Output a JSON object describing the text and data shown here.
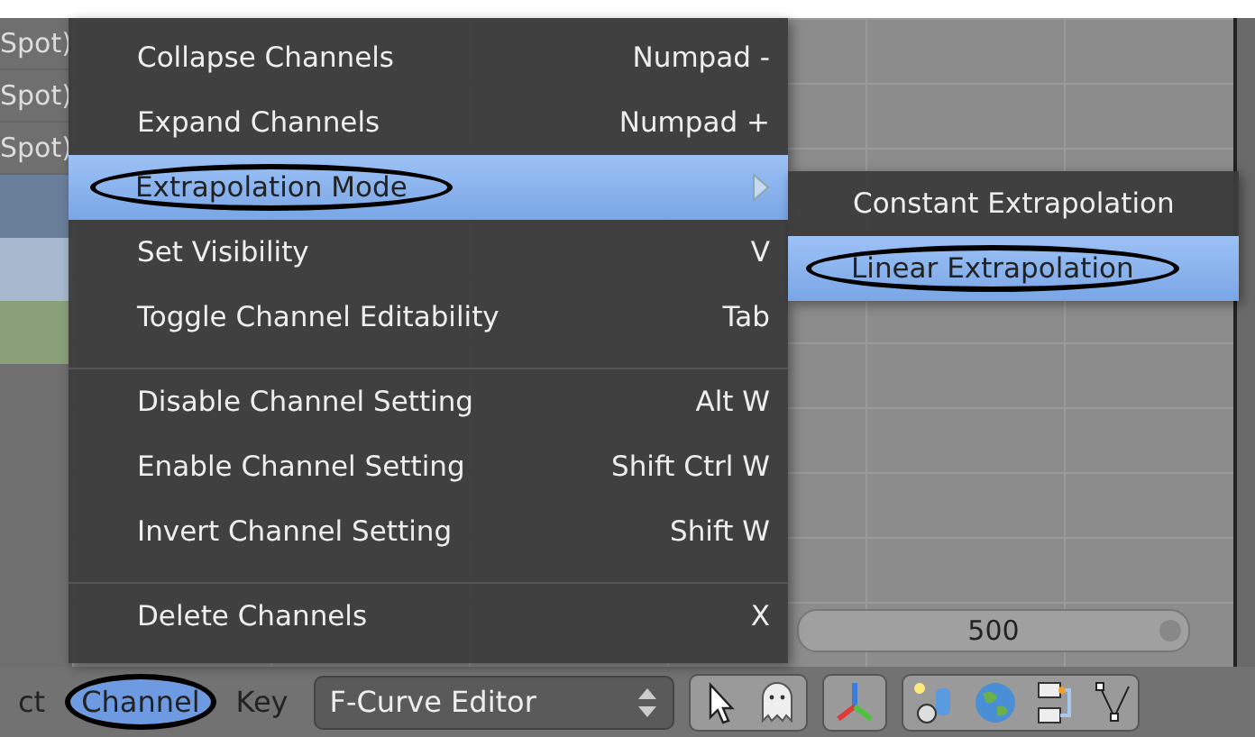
{
  "channel_list": [
    {
      "label": "Spot)"
    },
    {
      "label": "Spot)"
    },
    {
      "label": "Spot)"
    }
  ],
  "menu": {
    "items": [
      {
        "label": "Collapse Channels",
        "shortcut": "Numpad -",
        "selected": false,
        "circled": false,
        "kind": "plain",
        "separator_before": false
      },
      {
        "label": "Expand Channels",
        "shortcut": "Numpad +",
        "selected": false,
        "circled": false,
        "kind": "plain",
        "separator_before": false
      },
      {
        "label": "Extrapolation Mode",
        "selected": true,
        "circled": true,
        "kind": "submenu",
        "separator_before": false
      },
      {
        "label": "Set Visibility",
        "shortcut": "V",
        "selected": false,
        "circled": false,
        "kind": "plain",
        "separator_before": false
      },
      {
        "label": "Toggle Channel Editability",
        "shortcut": "Tab",
        "selected": false,
        "circled": false,
        "kind": "plain",
        "separator_before": false
      },
      {
        "label": "Disable Channel Setting",
        "shortcut": "Alt W",
        "selected": false,
        "circled": false,
        "kind": "plain",
        "separator_before": true
      },
      {
        "label": "Enable Channel Setting",
        "shortcut": "Shift Ctrl W",
        "selected": false,
        "circled": false,
        "kind": "plain",
        "separator_before": false
      },
      {
        "label": "Invert Channel Setting",
        "shortcut": "Shift W",
        "selected": false,
        "circled": false,
        "kind": "plain",
        "separator_before": false
      },
      {
        "label": "Delete Channels",
        "shortcut": "X",
        "selected": false,
        "circled": false,
        "kind": "plain",
        "separator_before": true
      }
    ]
  },
  "submenu": {
    "items": [
      {
        "label": "Constant Extrapolation",
        "selected": false,
        "circled": false
      },
      {
        "label": "Linear Extrapolation",
        "selected": true,
        "circled": true
      }
    ]
  },
  "scrollbar": {
    "value": "500"
  },
  "header": {
    "menus": [
      {
        "label": "ct",
        "selected": false,
        "circled": false
      },
      {
        "label": "Channel",
        "selected": true,
        "circled": true
      },
      {
        "label": "Key",
        "selected": false,
        "circled": false
      }
    ],
    "mode_dropdown": "F-Curve Editor"
  }
}
